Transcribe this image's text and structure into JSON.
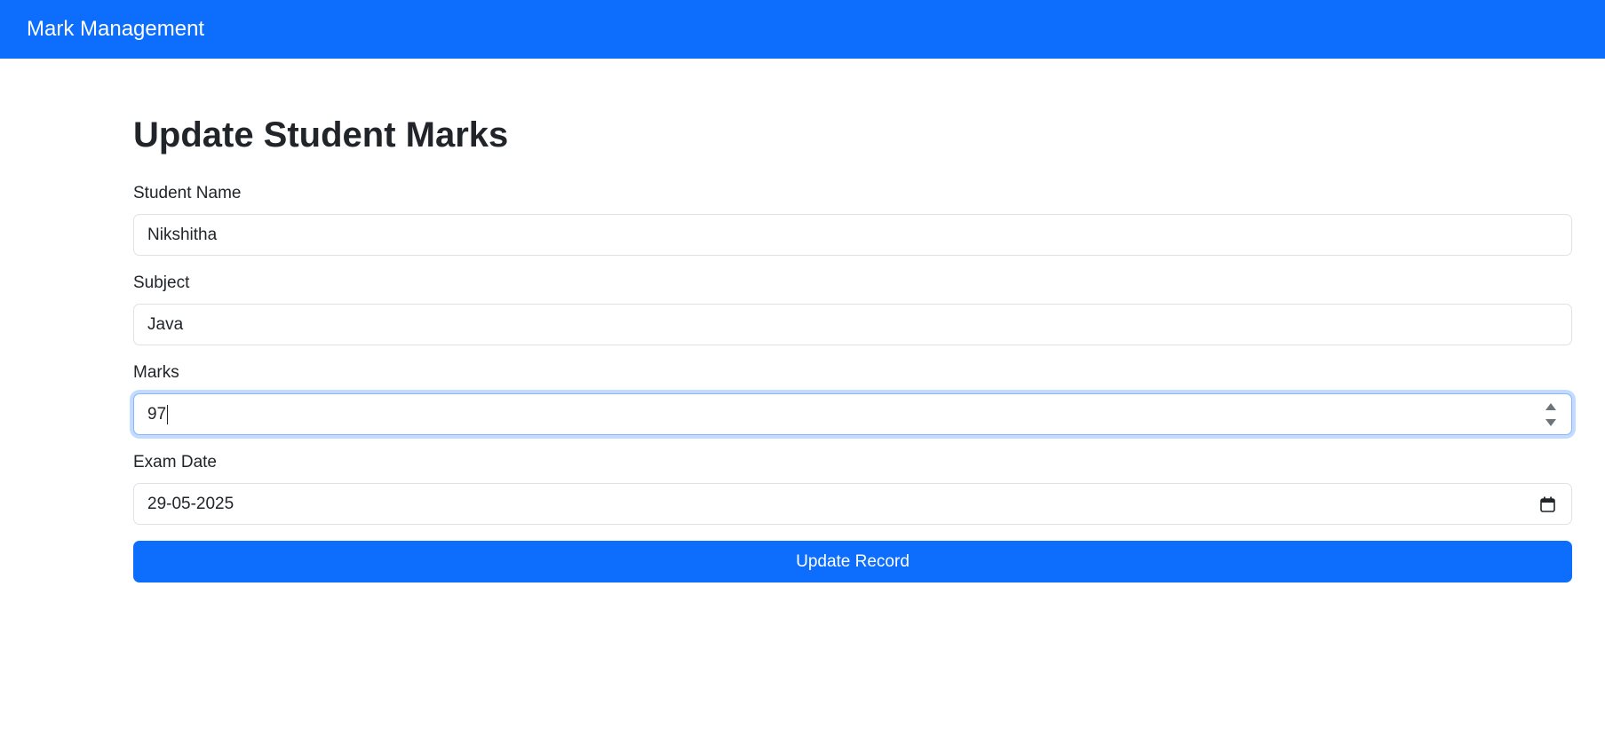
{
  "navbar": {
    "brand": "Mark Management",
    "background_color": "#0d6efd"
  },
  "page": {
    "title": "Update Student Marks"
  },
  "form": {
    "student_name": {
      "label": "Student Name",
      "value": "Nikshitha"
    },
    "subject": {
      "label": "Subject",
      "value": "Java"
    },
    "marks": {
      "label": "Marks",
      "value": "97"
    },
    "exam_date": {
      "label": "Exam Date",
      "value": "29-05-2025"
    },
    "submit_label": "Update Record"
  },
  "icons": {
    "spinner": "number-spinner-icon",
    "calendar": "calendar-icon"
  },
  "colors": {
    "accent": "#0d6efd",
    "focus_border": "#86b7fe",
    "text": "#212529"
  }
}
